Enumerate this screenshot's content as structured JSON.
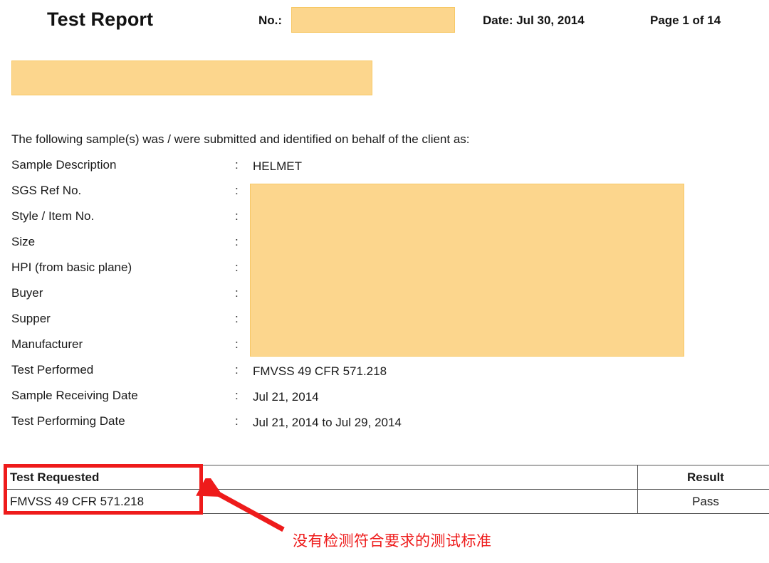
{
  "header": {
    "title": "Test Report",
    "no_label": "No.:",
    "no_value": "",
    "date": "Date: Jul 30, 2014",
    "page": "Page 1 of 14"
  },
  "intro": {
    "text": "The following sample(s) was / were submitted and identified on behalf of the client as:"
  },
  "fields": [
    {
      "label": "Sample Description",
      "colon": ":",
      "value": "HELMET"
    },
    {
      "label": "SGS Ref No.",
      "colon": ":",
      "value": ""
    },
    {
      "label": "Style / Item No.",
      "colon": ":",
      "value": ""
    },
    {
      "label": "Size",
      "colon": ":",
      "value": ""
    },
    {
      "label": "HPI (from basic plane)",
      "colon": ":",
      "value": ""
    },
    {
      "label": "Buyer",
      "colon": ":",
      "value": ""
    },
    {
      "label": "Supper",
      "colon": ":",
      "value": ""
    },
    {
      "label": "Manufacturer",
      "colon": ":",
      "value": ""
    },
    {
      "label": "Test Performed",
      "colon": ":",
      "value": "FMVSS 49 CFR 571.218"
    },
    {
      "label": "Sample Receiving Date",
      "colon": ":",
      "value": "Jul 21, 2014"
    },
    {
      "label": "Test Performing Date",
      "colon": ":",
      "value": "Jul 21, 2014 to Jul 29, 2014"
    }
  ],
  "results_table": {
    "headers": {
      "test_requested": "Test Requested",
      "result": "Result"
    },
    "rows": [
      {
        "test_requested": "FMVSS 49 CFR 571.218",
        "result": "Pass"
      }
    ]
  },
  "annotation": {
    "text": "没有检测符合要求的测试标准",
    "color": "#ee1b1b"
  },
  "colors": {
    "redaction": "#fcd68d",
    "redaction_border": "#f7c866",
    "annotation_red": "#ee1b1b",
    "table_border": "#555555",
    "text": "#1a1a1a"
  }
}
